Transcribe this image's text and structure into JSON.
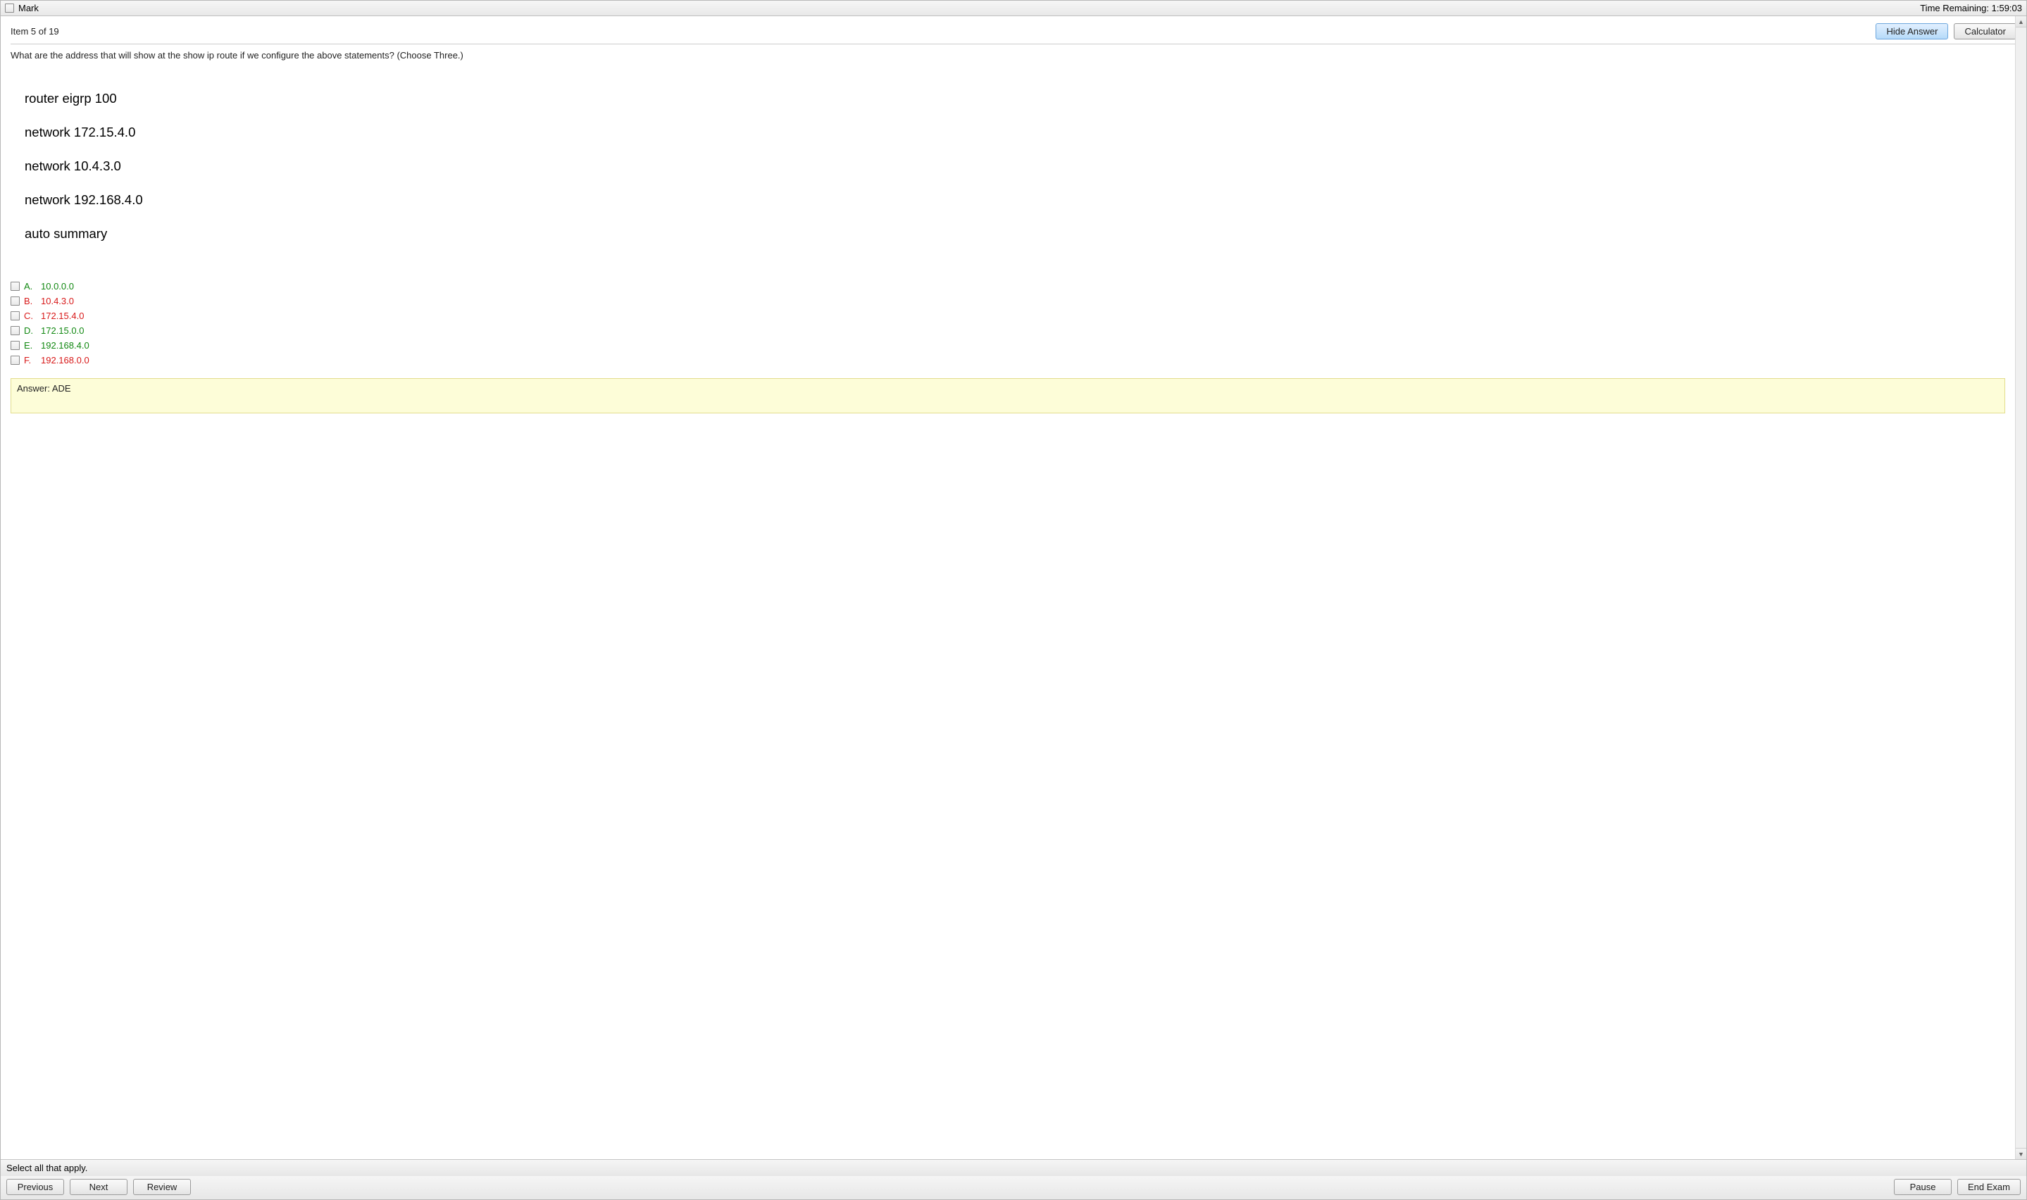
{
  "topbar": {
    "mark_label": "Mark",
    "time_label": "Time Remaining:",
    "time_value": "1:59:03"
  },
  "header": {
    "item_counter": "Item 5 of 19",
    "hide_answer_label": "Hide Answer",
    "calculator_label": "Calculator"
  },
  "question": {
    "text": "What are the address that will show at the show ip route if we configure the above statements? (Choose Three.)",
    "config_lines": [
      "router eigrp 100",
      "network 172.15.4.0",
      "network 10.4.3.0",
      "network 192.168.4.0",
      "auto summary"
    ]
  },
  "options": [
    {
      "letter": "A.",
      "text": "10.0.0.0",
      "correct": true
    },
    {
      "letter": "B.",
      "text": "10.4.3.0",
      "correct": false
    },
    {
      "letter": "C.",
      "text": "172.15.4.0",
      "correct": false
    },
    {
      "letter": "D.",
      "text": "172.15.0.0",
      "correct": true
    },
    {
      "letter": "E.",
      "text": "192.168.4.0",
      "correct": true
    },
    {
      "letter": "F.",
      "text": "192.168.0.0",
      "correct": false
    }
  ],
  "answer_box": "Answer: ADE",
  "instruction": "Select all that apply.",
  "bottom": {
    "previous": "Previous",
    "next": "Next",
    "review": "Review",
    "pause": "Pause",
    "end": "End Exam"
  }
}
